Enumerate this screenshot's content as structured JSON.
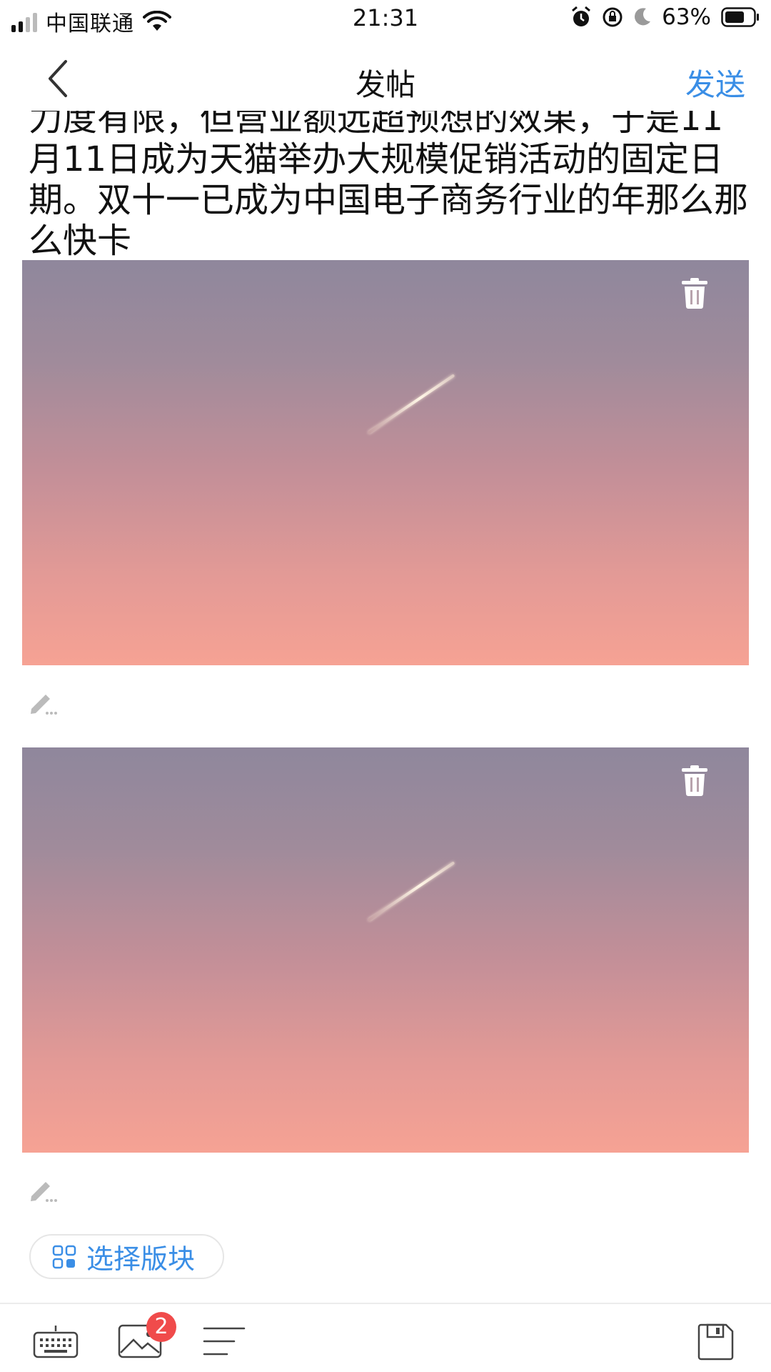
{
  "status_bar": {
    "carrier": "中国联通",
    "time": "21:31",
    "battery": "63%"
  },
  "nav": {
    "title": "发帖",
    "send_label": "发送"
  },
  "post": {
    "text": "力度有限，但营业额远超预想的效果，于是11月11日成为天猫举办大规模促销活动的固定日期。双十一已成为中国电子商务行业的年那么那么快卡"
  },
  "section_selector": {
    "label": "选择版块"
  },
  "toolbar": {
    "image_count": "2"
  },
  "colors": {
    "accent": "#3a8ee6",
    "badge": "#f04b4b"
  },
  "icons": [
    "back-icon",
    "trash-icon",
    "edit-icon",
    "grid-icon",
    "keyboard-icon",
    "image-icon",
    "format-icon",
    "save-icon"
  ]
}
